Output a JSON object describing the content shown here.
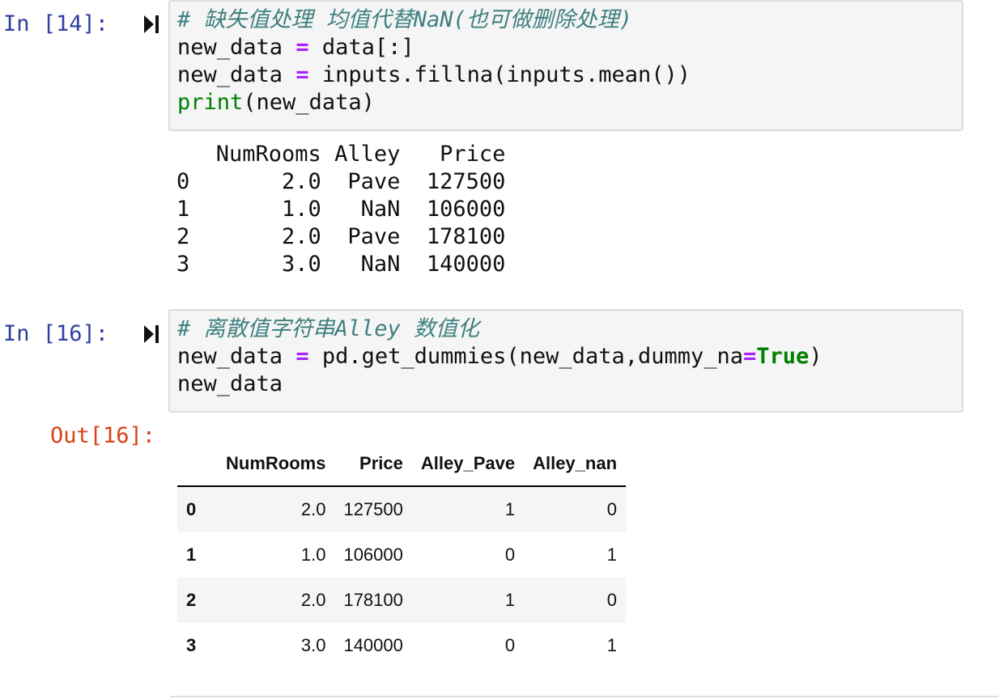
{
  "cells": [
    {
      "prompt": "In [14]:",
      "code": {
        "line1": {
          "comment": "# 缺失值处理 均值代替NaN(也可做删除处理)"
        },
        "line2": {
          "a": "new_data ",
          "op": "=",
          "b": " data[:]"
        },
        "line3": {
          "a": "new_data ",
          "op": "=",
          "b": " inputs.fillna(inputs.mean())"
        },
        "line4": {
          "builtin": "print",
          "rest": "(new_data)"
        }
      },
      "output_lines": [
        "   NumRooms Alley   Price",
        "0       2.0  Pave  127500",
        "1       1.0   NaN  106000",
        "2       2.0  Pave  178100",
        "3       3.0   NaN  140000"
      ]
    },
    {
      "prompt": "In [16]:",
      "code": {
        "line1": {
          "comment": "# 离散值字符串Alley 数值化"
        },
        "line2": {
          "a": "new_data ",
          "op": "=",
          "b": " pd.get_dummies(new_data,dummy_na",
          "op2": "=",
          "kw": "True",
          "c": ")"
        },
        "line3": {
          "a": "new_data"
        }
      },
      "out_prompt": "Out[16]:",
      "table": {
        "columns": [
          "NumRooms",
          "Price",
          "Alley_Pave",
          "Alley_nan"
        ],
        "rows": [
          {
            "index": "0",
            "values": [
              "2.0",
              "127500",
              "1",
              "0"
            ]
          },
          {
            "index": "1",
            "values": [
              "1.0",
              "106000",
              "0",
              "1"
            ]
          },
          {
            "index": "2",
            "values": [
              "2.0",
              "178100",
              "1",
              "0"
            ]
          },
          {
            "index": "3",
            "values": [
              "3.0",
              "140000",
              "0",
              "1"
            ]
          }
        ]
      }
    }
  ],
  "icons": {
    "run_cell": "run-to-here-icon"
  },
  "colors": {
    "in_prompt": "#303f9f",
    "out_prompt": "#d84315",
    "comment": "#408080",
    "operator": "#aa22ff",
    "keyword": "#008000"
  }
}
